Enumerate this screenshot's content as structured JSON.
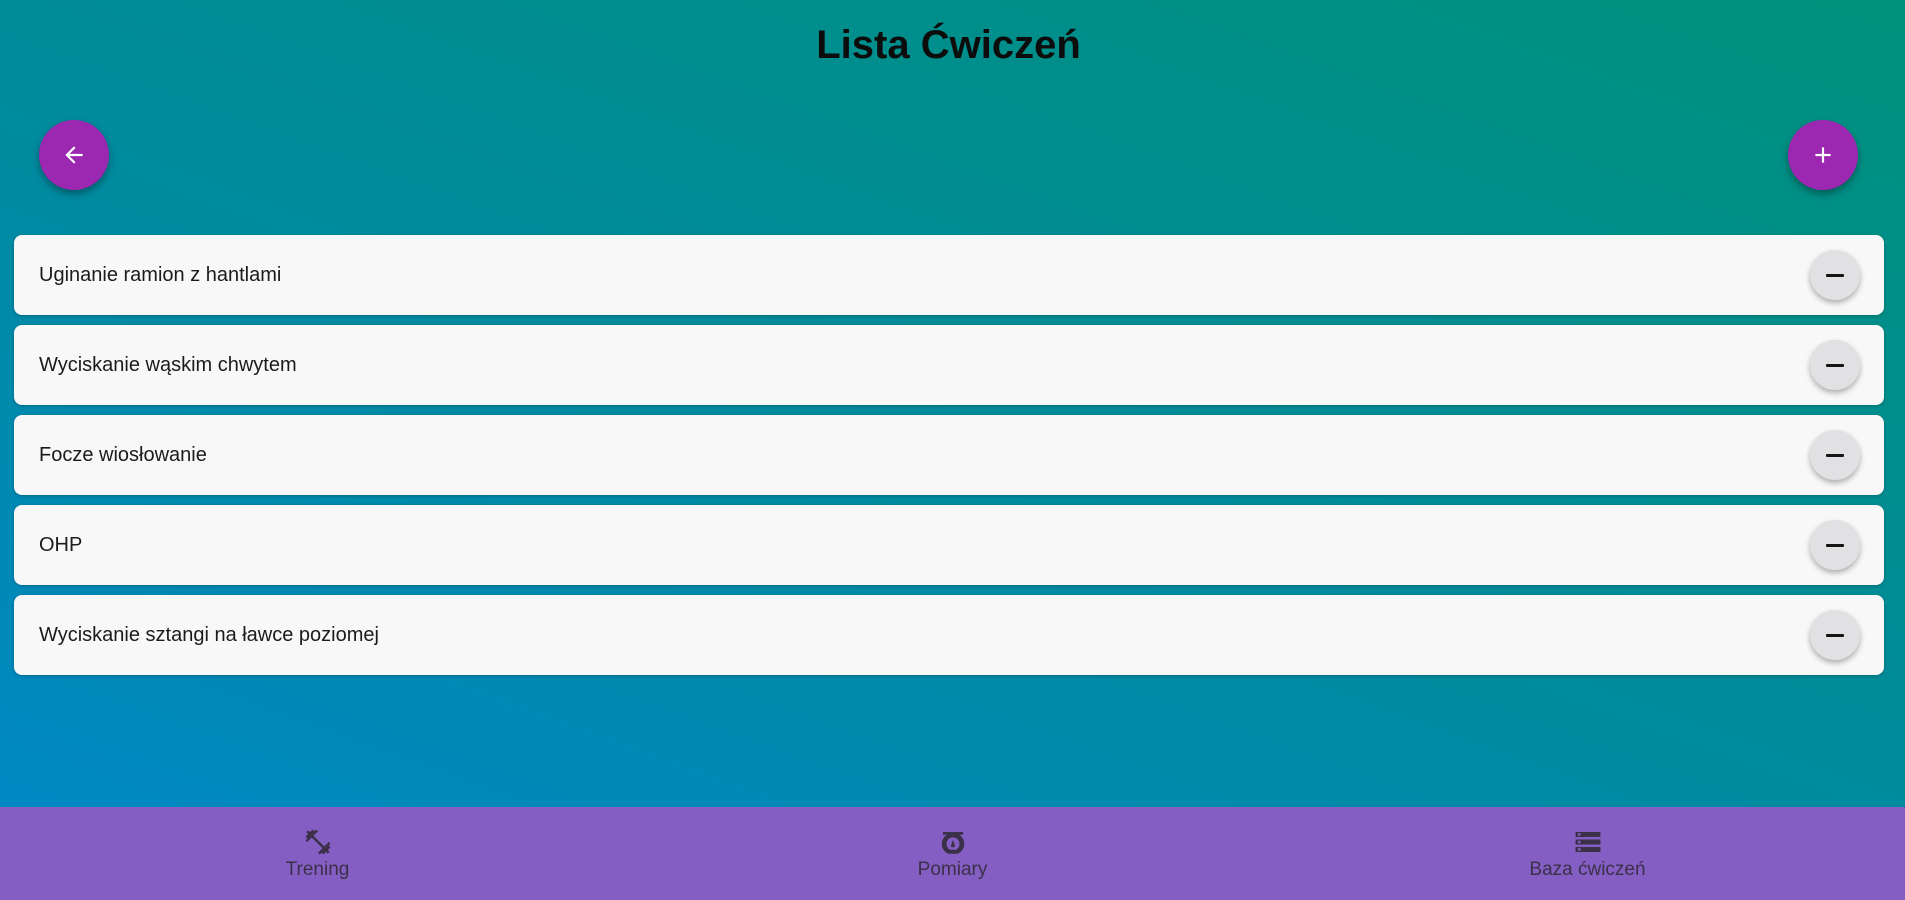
{
  "header": {
    "title": "Lista Ćwiczeń"
  },
  "actions": {
    "back_icon": "arrow-left-icon",
    "add_icon": "plus-icon",
    "accent_color": "#9c27b0"
  },
  "exercises": [
    {
      "name": "Uginanie ramion z hantlami"
    },
    {
      "name": "Wyciskanie wąskim chwytem"
    },
    {
      "name": "Focze wiosłowanie"
    },
    {
      "name": "OHP"
    },
    {
      "name": "Wyciskanie sztangi na ławce poziomej"
    }
  ],
  "bottom_nav": {
    "background_color": "#855ec4",
    "items": [
      {
        "label": "Trening",
        "icon": "dumbbell-icon"
      },
      {
        "label": "Pomiary",
        "icon": "scale-icon"
      },
      {
        "label": "Baza ćwiczeń",
        "icon": "storage-icon"
      }
    ]
  }
}
